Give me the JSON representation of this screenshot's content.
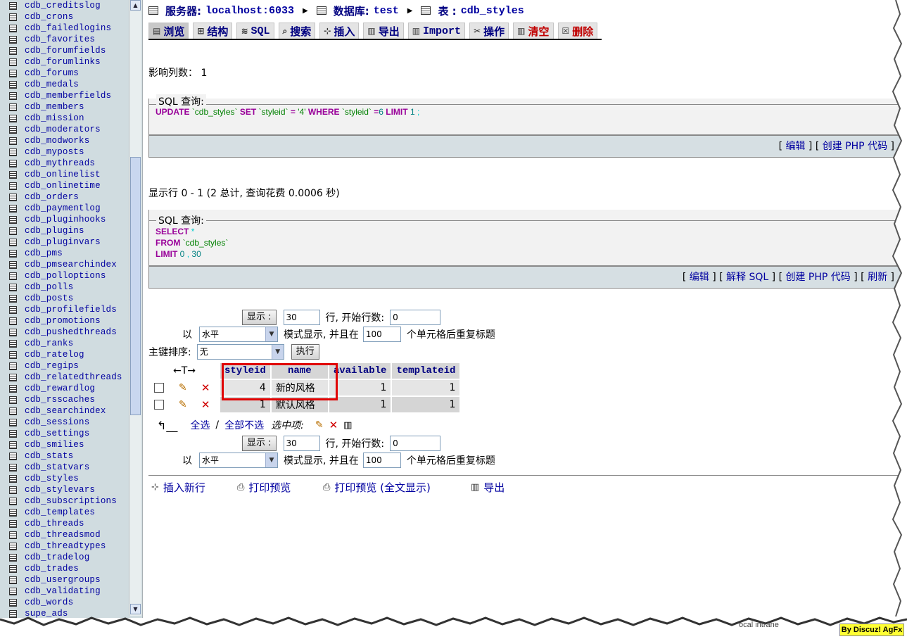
{
  "sidebar": {
    "tables": [
      "cdb_creditslog",
      "cdb_crons",
      "cdb_failedlogins",
      "cdb_favorites",
      "cdb_forumfields",
      "cdb_forumlinks",
      "cdb_forums",
      "cdb_medals",
      "cdb_memberfields",
      "cdb_members",
      "cdb_mission",
      "cdb_moderators",
      "cdb_modworks",
      "cdb_myposts",
      "cdb_mythreads",
      "cdb_onlinelist",
      "cdb_onlinetime",
      "cdb_orders",
      "cdb_paymentlog",
      "cdb_pluginhooks",
      "cdb_plugins",
      "cdb_pluginvars",
      "cdb_pms",
      "cdb_pmsearchindex",
      "cdb_polloptions",
      "cdb_polls",
      "cdb_posts",
      "cdb_profilefields",
      "cdb_promotions",
      "cdb_pushedthreads",
      "cdb_ranks",
      "cdb_ratelog",
      "cdb_regips",
      "cdb_relatedthreads",
      "cdb_rewardlog",
      "cdb_rsscaches",
      "cdb_searchindex",
      "cdb_sessions",
      "cdb_settings",
      "cdb_smilies",
      "cdb_stats",
      "cdb_statvars",
      "cdb_styles",
      "cdb_stylevars",
      "cdb_subscriptions",
      "cdb_templates",
      "cdb_threads",
      "cdb_threadsmod",
      "cdb_threadtypes",
      "cdb_tradelog",
      "cdb_trades",
      "cdb_usergroups",
      "cdb_validating",
      "cdb_words",
      "supe_ads"
    ]
  },
  "breadcrumb": {
    "server_label": "服务器:",
    "server_value": "localhost:6033",
    "db_label": "数据库:",
    "db_value": "test",
    "table_label": "表 :",
    "table_value": "cdb_styles"
  },
  "tabs": [
    {
      "label": "浏览",
      "icon": "▤"
    },
    {
      "label": "结构",
      "icon": "⊞"
    },
    {
      "label": "SQL",
      "icon": "≋"
    },
    {
      "label": "搜索",
      "icon": "⌕"
    },
    {
      "label": "插入",
      "icon": "⊹"
    },
    {
      "label": "导出",
      "icon": "▥"
    },
    {
      "label": "Import",
      "icon": "▥"
    },
    {
      "label": "操作",
      "icon": "✂"
    },
    {
      "label": "清空",
      "icon": "▥"
    },
    {
      "label": "删除",
      "icon": "☒"
    }
  ],
  "affected_rows": "影响列数： 1",
  "sql1": {
    "legend": "SQL 查询:",
    "links": {
      "edit": "编辑",
      "php": "创建 PHP 代码"
    }
  },
  "showing_rows": "显示行 0 - 1 (2 总计, 查询花费 0.0006 秒)",
  "sql2": {
    "legend": "SQL 查询:",
    "links": {
      "edit": "编辑",
      "explain": "解释 SQL",
      "php": "创建 PHP 代码",
      "refresh": "刷新"
    }
  },
  "nav": {
    "show_button": "显示 :",
    "rows_value": "30",
    "rows_text": "行, 开始行数:",
    "start_value": "0",
    "mode_prefix": "以",
    "mode_value": "水平",
    "mode_text": "模式显示, 并且在",
    "repeat_value": "100",
    "repeat_text": "个单元格后重复标题",
    "sort_label": "主键排序:",
    "sort_value": "无",
    "execute_button": "执行"
  },
  "results": {
    "arrows": "←T→",
    "columns": [
      "styleid",
      "name",
      "available",
      "templateid"
    ],
    "rows": [
      {
        "styleid": "4",
        "name": "新的风格",
        "available": "1",
        "templateid": "1"
      },
      {
        "styleid": "1",
        "name": "默认风格",
        "available": "1",
        "templateid": "1"
      }
    ]
  },
  "selection": {
    "check_all": "全选",
    "sep": "/",
    "uncheck_all": "全部不选",
    "with_selected": "选中项:"
  },
  "bottom": {
    "insert_row": "插入新行",
    "print_view": "打印预览",
    "print_view_full": "打印预览 (全文显示)",
    "export": "导出"
  },
  "statusbar": {
    "zone": "ocal intrane"
  },
  "watermark": "By Discuz! AgFx",
  "colors": {
    "link": "#0000a0",
    "keyword": "#990099",
    "identifier": "#008000",
    "highlight_box": "#e00000",
    "left_bg": "#d0dce0"
  }
}
